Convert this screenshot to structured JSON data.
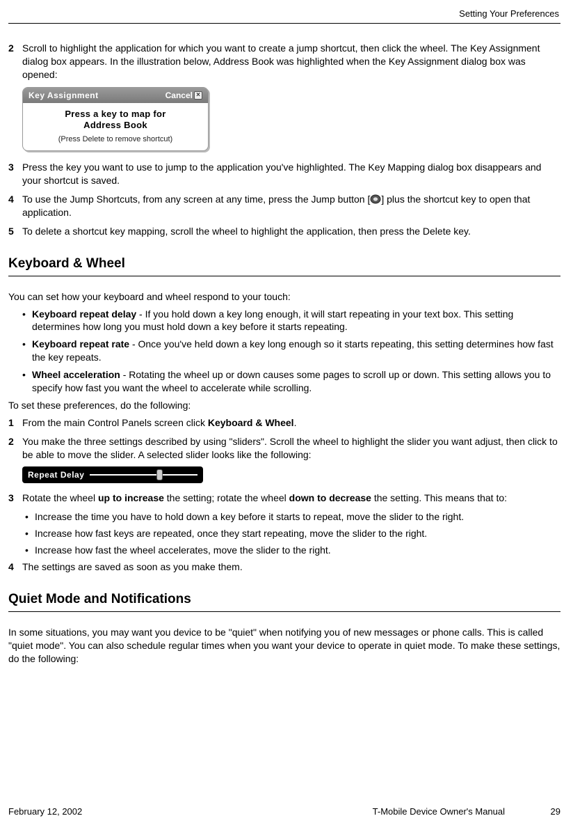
{
  "header": {
    "section_title": "Setting Your Preferences"
  },
  "steps_a": {
    "s2": {
      "num": "2",
      "text": "Scroll to highlight the application for which you want to create a jump shortcut, then click the wheel. The Key Assignment dialog box appears. In the illustration below, Address Book was highlighted when the Key Assignment dialog box was opened:"
    },
    "s3": {
      "num": "3",
      "text": "Press the key you want to use to jump to the application you've highlighted. The Key Mapping dialog box disappears and your shortcut is saved."
    },
    "s4": {
      "num": "4",
      "pre": "To use the Jump Shortcuts, from any screen at any time, press the Jump button [",
      "post": "] plus the shortcut key to open that application."
    },
    "s5": {
      "num": "5",
      "text": "To delete a shortcut key mapping, scroll the wheel to highlight the application, then press the Delete key."
    }
  },
  "dialog": {
    "title": "Key Assignment",
    "cancel": "Cancel",
    "line1": "Press a key to map for",
    "line2": "Address Book",
    "hint": "(Press Delete to remove shortcut)"
  },
  "h_kw": "Keyboard & Wheel",
  "kw_intro": "You can set how your keyboard and wheel respond to your touch:",
  "kw_bullets": {
    "b1": {
      "label": "Keyboard repeat delay",
      "text": " - If you hold down a key long enough, it will start repeating in your text box. This setting determines how long you must hold down a key before it starts repeating."
    },
    "b2": {
      "label": "Keyboard repeat rate",
      "text": " - Once you've held down a key long enough so it starts repeating, this setting determines how fast the key repeats."
    },
    "b3": {
      "label": "Wheel acceleration",
      "text": " - Rotating the wheel up or down causes some pages to scroll up or down. This setting allows you to specify how fast you want the wheel to accelerate while scrolling."
    }
  },
  "kw_set": "To set these preferences, do the following:",
  "kw_steps": {
    "s1": {
      "num": "1",
      "pre": "From the main Control Panels screen click ",
      "bold": "Keyboard & Wheel",
      "post": "."
    },
    "s2": {
      "num": "2",
      "text": "You make the three settings described by using \"sliders\". Scroll the wheel to highlight the slider you want adjust, then click to be able to move the slider. A selected slider looks like the following:"
    },
    "s3": {
      "num": "3",
      "pre": "Rotate the wheel ",
      "b1": "up to increase",
      "mid": " the setting; rotate the wheel ",
      "b2": "down to decrease",
      "post": " the setting. This means that to:"
    },
    "s4": {
      "num": "4",
      "text": "The settings are saved as soon as you make them."
    }
  },
  "slider": {
    "label": "Repeat Delay"
  },
  "s3_sub": {
    "a": "Increase the time you have to hold down a key before it starts to repeat, move the slider to the right.",
    "b": "Increase how fast keys are repeated, once they start repeating, move the slider to the right.",
    "c": "Increase how fast the wheel accelerates, move the slider to the right."
  },
  "h_qm": "Quiet Mode and Notifications",
  "qm_p": "In some situations, you may want you device to be \"quiet\" when notifying you of new messages or phone calls. This is called \"quiet mode\". You can also schedule regular times when you want your device to operate in quiet mode. To make these settings, do the following:",
  "footer": {
    "date": "February 12, 2002",
    "title": "T-Mobile Device Owner's Manual",
    "page": "29"
  }
}
